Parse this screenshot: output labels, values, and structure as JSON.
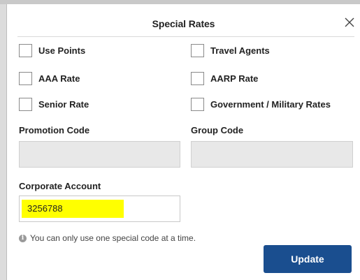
{
  "dialog": {
    "title": "Special Rates",
    "close_icon": "close-icon"
  },
  "checkboxes": [
    {
      "label": "Use Points",
      "checked": false
    },
    {
      "label": "Travel Agents",
      "checked": false
    },
    {
      "label": "AAA Rate",
      "checked": false
    },
    {
      "label": "AARP Rate",
      "checked": false
    },
    {
      "label": "Senior Rate",
      "checked": false
    },
    {
      "label": "Government / Military Rates",
      "checked": false
    }
  ],
  "fields": {
    "promotion_code": {
      "label": "Promotion Code",
      "value": ""
    },
    "group_code": {
      "label": "Group Code",
      "value": ""
    },
    "corporate_account": {
      "label": "Corporate Account",
      "value": "3256788",
      "highlight_color": "#ffff00"
    }
  },
  "info": {
    "icon": "info-icon",
    "text": "You can only use one special code at a time."
  },
  "buttons": {
    "update_label": "Update",
    "update_color": "#1a4e8f"
  }
}
